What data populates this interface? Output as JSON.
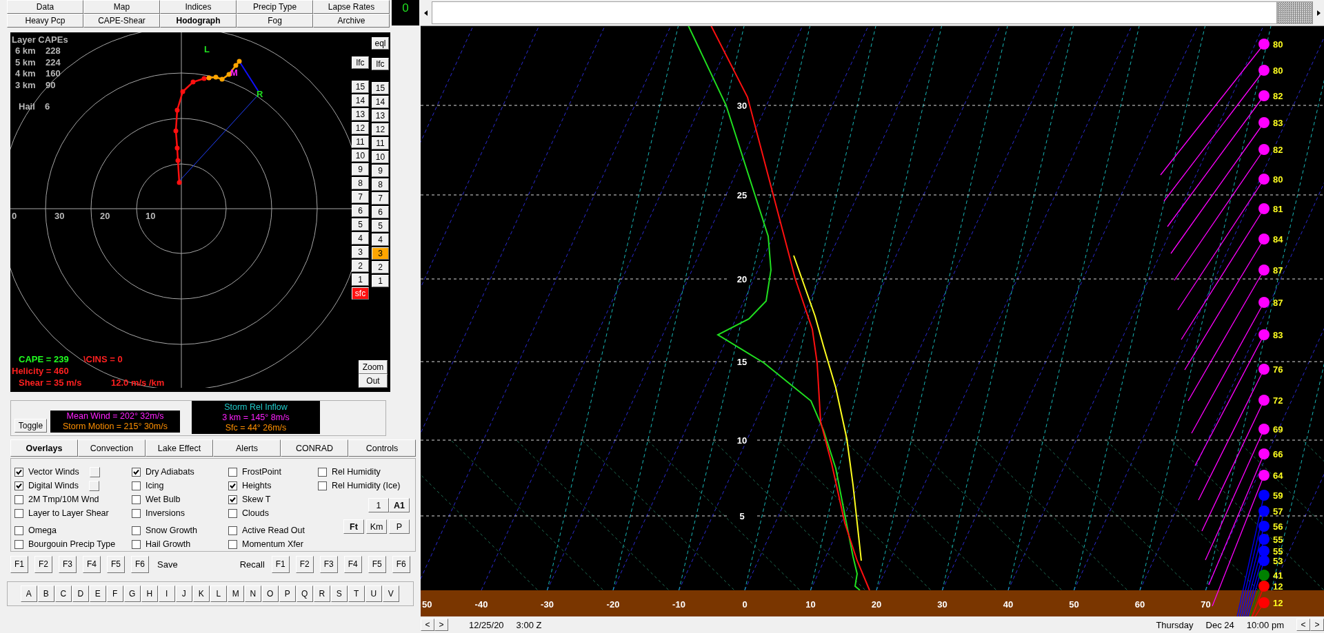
{
  "top_tabs": [
    {
      "label": "Data",
      "selected": false
    },
    {
      "label": "Map",
      "selected": false
    },
    {
      "label": "Indices",
      "selected": false
    },
    {
      "label": "Precip Type",
      "selected": false
    },
    {
      "label": "Lapse Rates",
      "selected": false
    },
    {
      "label": "Heavy Pcp",
      "selected": false
    },
    {
      "label": "CAPE-Shear",
      "selected": false
    },
    {
      "label": "Hodograph",
      "selected": true
    },
    {
      "label": "Fog",
      "selected": false
    },
    {
      "label": "Archive",
      "selected": false
    }
  ],
  "counter": "0",
  "hodograph": {
    "layer_capes_title": "Layer CAPEs",
    "layer_capes": [
      {
        "layer": "6 km",
        "value": "228"
      },
      {
        "layer": "5 km",
        "value": "224"
      },
      {
        "layer": "4 km",
        "value": "160"
      },
      {
        "layer": "3 km",
        "value": "90"
      }
    ],
    "hail_label": "Hail",
    "hail_value": "6",
    "ring_labels": [
      "0",
      "30",
      "20",
      "10"
    ],
    "marker_left": "L",
    "marker_mean": "M",
    "marker_right": "R",
    "cape": "CAPE =  239",
    "cins": "\\CINS =  0",
    "helicity": "Helicity =  460",
    "shear": "Shear =  35 m/s",
    "shear_rate": "12.0 m/s /km"
  },
  "level_buttons": {
    "left": [
      {
        "label": "lfc",
        "selected": false
      },
      {
        "label": "15",
        "selected": false
      },
      {
        "label": "14",
        "selected": false
      },
      {
        "label": "13",
        "selected": false
      },
      {
        "label": "12",
        "selected": false
      },
      {
        "label": "11",
        "selected": false
      },
      {
        "label": "10",
        "selected": false
      },
      {
        "label": "9",
        "selected": false
      },
      {
        "label": "8",
        "selected": false
      },
      {
        "label": "7",
        "selected": false
      },
      {
        "label": "6",
        "selected": false
      },
      {
        "label": "5",
        "selected": false
      },
      {
        "label": "4",
        "selected": false
      },
      {
        "label": "3",
        "selected": false
      },
      {
        "label": "2",
        "selected": false
      },
      {
        "label": "1",
        "selected": false
      },
      {
        "label": "sfc",
        "selected": true
      }
    ],
    "right": [
      {
        "label": "eql",
        "selected": false
      },
      {
        "label": "lfc",
        "selected": false
      },
      {
        "label": "15",
        "selected": false
      },
      {
        "label": "14",
        "selected": false
      },
      {
        "label": "13",
        "selected": false
      },
      {
        "label": "12",
        "selected": false
      },
      {
        "label": "11",
        "selected": false
      },
      {
        "label": "10",
        "selected": false
      },
      {
        "label": "9",
        "selected": false
      },
      {
        "label": "8",
        "selected": false
      },
      {
        "label": "7",
        "selected": false
      },
      {
        "label": "6",
        "selected": false
      },
      {
        "label": "5",
        "selected": false
      },
      {
        "label": "4",
        "selected": false
      },
      {
        "label": "3",
        "selected": true
      },
      {
        "label": "2",
        "selected": false
      },
      {
        "label": "1",
        "selected": false
      }
    ]
  },
  "zoom_buttons": [
    "Zoom",
    "Out"
  ],
  "wind_info": {
    "toggle": "Toggle",
    "mean_wind": "Mean Wind = 202°  32m/s",
    "storm_motion": "Storm Motion = 215°  30m/s",
    "inflow_title": "Storm Rel Inflow",
    "inflow_3km": "3 km = 145°  8m/s",
    "inflow_sfc": "Sfc  = 44°  26m/s"
  },
  "overlay_tabs": [
    {
      "label": "Overlays",
      "selected": true
    },
    {
      "label": "Convection",
      "selected": false
    },
    {
      "label": "Lake Effect",
      "selected": false
    },
    {
      "label": "Alerts",
      "selected": false
    },
    {
      "label": "CONRAD",
      "selected": false
    },
    {
      "label": "Controls",
      "selected": false
    }
  ],
  "overlay_columns": [
    [
      {
        "label": "Vector Winds",
        "checked": true,
        "kind": "with_button"
      },
      {
        "label": "Digital Winds",
        "checked": true,
        "kind": "with_button"
      },
      {
        "label": "2M Tmp/10M Wnd",
        "checked": false,
        "kind": "plain"
      },
      {
        "label": "Layer to Layer Shear",
        "checked": false,
        "kind": "plain"
      },
      {
        "label": "Omega",
        "checked": false,
        "kind": "plain"
      },
      {
        "label": "Bourgouin Precip Type",
        "checked": false,
        "kind": "plain"
      }
    ],
    [
      {
        "label": "Dry Adiabats",
        "checked": true,
        "kind": "plain"
      },
      {
        "label": "Icing",
        "checked": false,
        "kind": "plain"
      },
      {
        "label": "Wet Bulb",
        "checked": false,
        "kind": "plain"
      },
      {
        "label": "Inversions",
        "checked": false,
        "kind": "plain"
      },
      {
        "label": "Snow Growth",
        "checked": false,
        "kind": "plain"
      },
      {
        "label": "Hail Growth",
        "checked": false,
        "kind": "plain"
      }
    ],
    [
      {
        "label": "FrostPoint",
        "checked": false,
        "kind": "plain"
      },
      {
        "label": "Heights",
        "checked": true,
        "kind": "plain"
      },
      {
        "label": "Skew T",
        "checked": true,
        "kind": "plain"
      },
      {
        "label": "Clouds",
        "checked": false,
        "kind": "plain"
      },
      {
        "label": "Active Read Out",
        "checked": false,
        "kind": "plain"
      },
      {
        "label": "Momentum Xfer",
        "checked": false,
        "kind": "plain"
      }
    ],
    [
      {
        "label": "Rel Humidity",
        "checked": false,
        "kind": "plain"
      },
      {
        "label": "Rel Humidity (Ice)",
        "checked": false,
        "kind": "plain"
      }
    ]
  ],
  "scale_buttons": [
    {
      "label": "1",
      "selected": false
    },
    {
      "label": "A1",
      "selected": true
    }
  ],
  "unit_buttons": [
    {
      "label": "Ft",
      "selected": true
    },
    {
      "label": "Km",
      "selected": false
    },
    {
      "label": "P",
      "selected": false
    }
  ],
  "save_keys": [
    "F1",
    "F2",
    "F3",
    "F4",
    "F5",
    "F6"
  ],
  "save_label": "Save",
  "recall_label": "Recall",
  "recall_keys": [
    "F1",
    "F2",
    "F3",
    "F4",
    "F5",
    "F6"
  ],
  "letter_keys": [
    "A",
    "B",
    "C",
    "D",
    "E",
    "F",
    "G",
    "H",
    "I",
    "J",
    "K",
    "L",
    "M",
    "N",
    "O",
    "P",
    "Q",
    "R",
    "S",
    "T",
    "U",
    "V"
  ],
  "skew_t": {
    "height_labels": [
      "30",
      "25",
      "20",
      "15",
      "10",
      "5"
    ],
    "temperature_labels": [
      "50",
      "-40",
      "-30",
      "-20",
      "-10",
      "0",
      "10",
      "20",
      "30",
      "40",
      "50",
      "60",
      "70"
    ],
    "winds": [
      {
        "speed": "80",
        "color": "#ff00ff"
      },
      {
        "speed": "80",
        "color": "#ff00ff"
      },
      {
        "speed": "82",
        "color": "#ff00ff"
      },
      {
        "speed": "83",
        "color": "#ff00ff"
      },
      {
        "speed": "82",
        "color": "#ff00ff"
      },
      {
        "speed": "80",
        "color": "#ff00ff"
      },
      {
        "speed": "81",
        "color": "#ff00ff"
      },
      {
        "speed": "84",
        "color": "#ff00ff"
      },
      {
        "speed": "87",
        "color": "#ff00ff"
      },
      {
        "speed": "87",
        "color": "#ff00ff"
      },
      {
        "speed": "83",
        "color": "#ff00ff"
      },
      {
        "speed": "76",
        "color": "#ff00ff"
      },
      {
        "speed": "72",
        "color": "#ff00ff"
      },
      {
        "speed": "69",
        "color": "#ff00ff"
      },
      {
        "speed": "66",
        "color": "#ff00ff"
      },
      {
        "speed": "64",
        "color": "#ff00ff"
      },
      {
        "speed": "59",
        "color": "#0000ff"
      },
      {
        "speed": "57",
        "color": "#0000ff"
      },
      {
        "speed": "56",
        "color": "#0000ff"
      },
      {
        "speed": "55",
        "color": "#0000ff"
      },
      {
        "speed": "55",
        "color": "#0000ff"
      },
      {
        "speed": "53",
        "color": "#0000ff"
      },
      {
        "speed": "41",
        "color": "#008000"
      },
      {
        "speed": "12",
        "color": "#ff0000"
      },
      {
        "speed": "12",
        "color": "#ff0000"
      }
    ]
  },
  "status": {
    "nav_prev": "<",
    "nav_next": ">",
    "date": "12/25/20",
    "time": "3:00 Z",
    "day": "Thursday",
    "local_date": "Dec 24",
    "local_time": "10:00 pm",
    "nav_prev_right": "<",
    "nav_next_right": ">"
  }
}
